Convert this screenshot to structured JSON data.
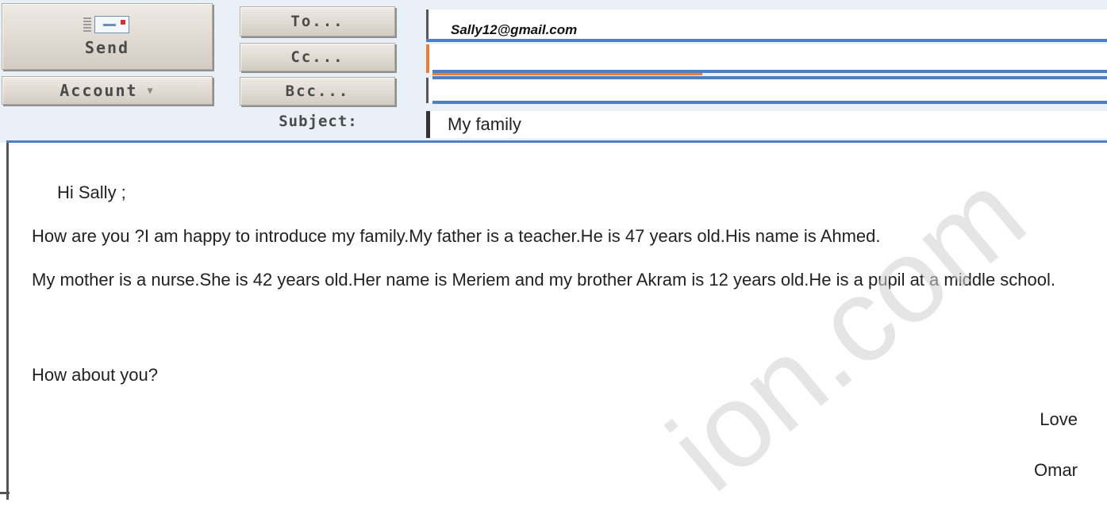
{
  "toolbar": {
    "send_label": "Send",
    "account_label": "Account",
    "to_label": "To...",
    "cc_label": "Cc...",
    "bcc_label": "Bcc...",
    "subject_label": "Subject:"
  },
  "fields": {
    "to_value": "Sally12@gmail.com",
    "cc_value": "",
    "bcc_value": "",
    "subject_value": "My family"
  },
  "message": {
    "greeting": "Hi Sally ;",
    "paragraph1": "How are you ?I am happy to introduce my family.My father is a teacher.He is 47 years old.His name is Ahmed.",
    "paragraph2": "My mother is a nurse.She is 42 years old.Her name is Meriem and my brother Akram is 12 years old.He is a pupil at a middle school.",
    "paragraph3": "How about you?",
    "closing": "Love",
    "signature": "Omar"
  },
  "watermark": {
    "text": "ion.com"
  },
  "colors": {
    "header_bg": "#e9f0f8",
    "accent_blue": "#4f7ec1",
    "accent_orange": "#ed7d31",
    "button_face": "#dcd5cc"
  },
  "icons": {
    "send": "envelope-icon",
    "account_dropdown": "chevron-down-icon"
  }
}
